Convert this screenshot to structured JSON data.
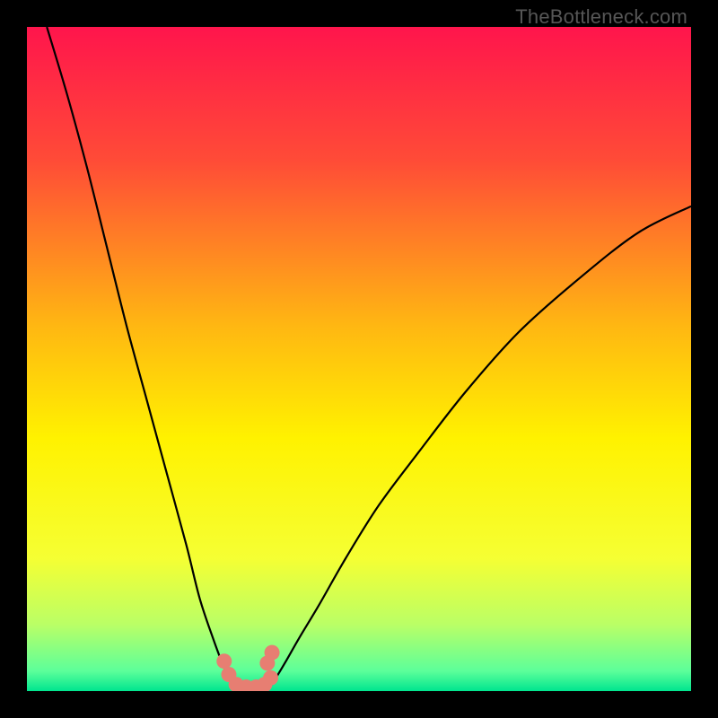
{
  "watermark": "TheBottleneck.com",
  "chart_data": {
    "type": "line",
    "title": "",
    "xlabel": "",
    "ylabel": "",
    "xlim": [
      0,
      100
    ],
    "ylim": [
      0,
      100
    ],
    "grid": false,
    "legend": false,
    "gradient_stops": [
      {
        "pct": 0,
        "color": "#ff154c"
      },
      {
        "pct": 20,
        "color": "#ff4b37"
      },
      {
        "pct": 45,
        "color": "#ffb712"
      },
      {
        "pct": 62,
        "color": "#fff200"
      },
      {
        "pct": 80,
        "color": "#f5ff33"
      },
      {
        "pct": 90,
        "color": "#baff66"
      },
      {
        "pct": 97,
        "color": "#5cff9a"
      },
      {
        "pct": 100,
        "color": "#00e58f"
      }
    ],
    "series": [
      {
        "name": "left-branch",
        "x": [
          3,
          6,
          9,
          12,
          15,
          18,
          21,
          24,
          26,
          28,
          29.5,
          30.5,
          31.3
        ],
        "y": [
          100,
          90,
          79,
          67,
          55,
          44,
          33,
          22,
          14,
          8,
          4,
          2,
          0.5
        ]
      },
      {
        "name": "right-branch",
        "x": [
          36.5,
          37.5,
          39,
          41,
          44,
          48,
          53,
          59,
          66,
          74,
          83,
          92,
          100
        ],
        "y": [
          0.5,
          2,
          4.5,
          8,
          13,
          20,
          28,
          36,
          45,
          54,
          62,
          69,
          73
        ]
      },
      {
        "name": "trough-markers",
        "type": "scatter",
        "color": "#e77e72",
        "x": [
          29.7,
          30.4,
          31.5,
          33.0,
          34.5,
          35.8,
          36.7,
          36.2,
          36.9
        ],
        "y": [
          4.5,
          2.5,
          1.0,
          0.6,
          0.6,
          1.0,
          2.0,
          4.2,
          5.8
        ]
      }
    ]
  }
}
